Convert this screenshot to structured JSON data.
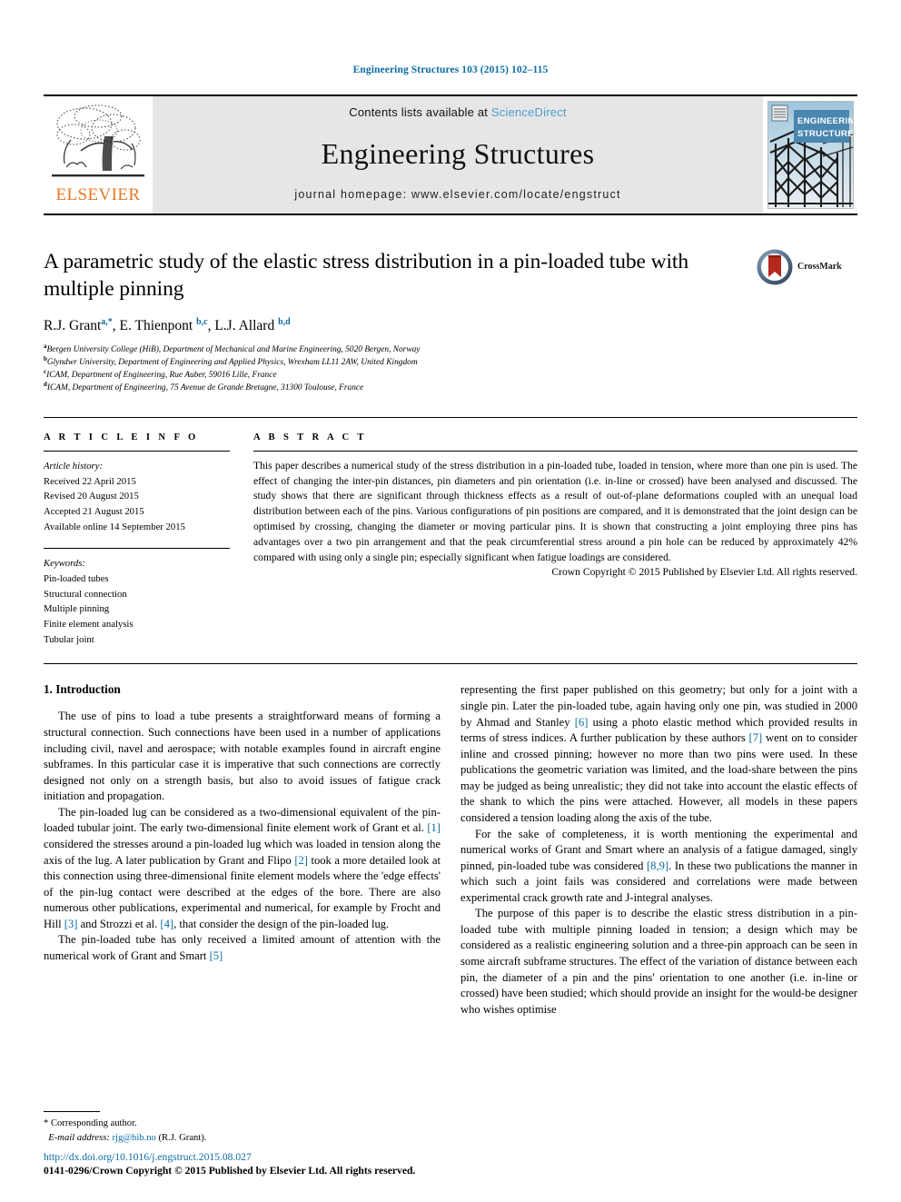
{
  "running_head": "Engineering Structures 103 (2015) 102–115",
  "banner": {
    "publisher_name": "ELSEVIER",
    "contents_prefix": "Contents lists available at ",
    "contents_link": "ScienceDirect",
    "journal_title": "Engineering Structures",
    "homepage": "journal homepage: www.elsevier.com/locate/engstruct",
    "cover_title_line1": "ENGINEERING",
    "cover_title_line2": "STRUCTURES"
  },
  "article": {
    "title": "A parametric study of the elastic stress distribution in a pin-loaded tube with multiple pinning",
    "crossmark_label": "CrossMark",
    "authors_html": "R.J. Grant<sup>a,*</sup>, E. Thienpont <sup>b,c</sup>, L.J. Allard <sup>b,d</sup>",
    "affiliations": [
      {
        "marker": "a",
        "text": "Bergen University College (HiB), Department of Mechanical and Marine Engineering, 5020 Bergen, Norway"
      },
      {
        "marker": "b",
        "text": "Glyndwr University, Department of Engineering and Applied Physics, Wrexham LL11 2AW, United Kingdom"
      },
      {
        "marker": "c",
        "text": "ICAM, Department of Engineering, Rue Auber, 59016 Lille, France"
      },
      {
        "marker": "d",
        "text": "ICAM, Department of Engineering, 75 Avenue de Grande Bretagne, 31300 Toulouse, France"
      }
    ]
  },
  "article_info": {
    "heading": "A R T I C L E   I N F O",
    "history_label": "Article history:",
    "history": [
      "Received 22 April 2015",
      "Revised 20 August 2015",
      "Accepted 21 August 2015",
      "Available online 14 September 2015"
    ],
    "keywords_label": "Keywords:",
    "keywords": [
      "Pin-loaded tubes",
      "Structural connection",
      "Multiple pinning",
      "Finite element analysis",
      "Tubular joint"
    ]
  },
  "abstract": {
    "heading": "A B S T R A C T",
    "text": "This paper describes a numerical study of the stress distribution in a pin-loaded tube, loaded in tension, where more than one pin is used. The effect of changing the inter-pin distances, pin diameters and pin orientation (i.e. in-line or crossed) have been analysed and discussed. The study shows that there are significant through thickness effects as a result of out-of-plane deformations coupled with an unequal load distribution between each of the pins. Various configurations of pin positions are compared, and it is demonstrated that the joint design can be optimised by crossing, changing the diameter or moving particular pins. It is shown that constructing a joint employing three pins has advantages over a two pin arrangement and that the peak circumferential stress around a pin hole can be reduced by approximately 42% compared with using only a single pin; especially significant when fatigue loadings are considered.",
    "copyright": "Crown Copyright © 2015 Published by Elsevier Ltd. All rights reserved."
  },
  "body": {
    "section_title": "1. Introduction",
    "left_paragraphs": [
      {
        "parts": [
          {
            "t": "The use of pins to load a tube presents a straightforward means of forming a structural connection. Such connections have been used in a number of applications including civil, navel and aerospace; with notable examples found in aircraft engine subframes. In this particular case it is imperative that such connections are correctly designed not only on a strength basis, but also to avoid issues of fatigue crack initiation and propagation."
          }
        ]
      },
      {
        "parts": [
          {
            "t": "The pin-loaded lug can be considered as a two-dimensional equivalent of the pin-loaded tubular joint. The early two-dimensional finite element work of Grant et al. "
          },
          {
            "t": "[1]",
            "ref": true
          },
          {
            "t": " considered the stresses around a pin-loaded lug which was loaded in tension along the axis of the lug. A later publication by Grant and Flipo "
          },
          {
            "t": "[2]",
            "ref": true
          },
          {
            "t": " took a more detailed look at this connection using three-dimensional finite element models where the 'edge effects' of the pin-lug contact were described at the edges of the bore. There are also numerous other publications, experimental and numerical, for example by Frocht and Hill "
          },
          {
            "t": "[3]",
            "ref": true
          },
          {
            "t": " and Strozzi et al. "
          },
          {
            "t": "[4]",
            "ref": true
          },
          {
            "t": ", that consider the design of the pin-loaded lug."
          }
        ]
      },
      {
        "parts": [
          {
            "t": "The pin-loaded tube has only received a limited amount of attention with the numerical work of Grant and Smart "
          },
          {
            "t": "[5]",
            "ref": true
          }
        ]
      }
    ],
    "right_paragraphs": [
      {
        "no_indent": true,
        "parts": [
          {
            "t": "representing the first paper published on this geometry; but only for a joint with a single pin. Later the pin-loaded tube, again having only one pin, was studied in 2000 by Ahmad and Stanley "
          },
          {
            "t": "[6]",
            "ref": true
          },
          {
            "t": " using a photo elastic method which provided results in terms of stress indices. A further publication by these authors "
          },
          {
            "t": "[7]",
            "ref": true
          },
          {
            "t": " went on to consider inline and crossed pinning; however no more than two pins were used. In these publications the geometric variation was limited, and the load-share between the pins may be judged as being unrealistic; they did not take into account the elastic effects of the shank to which the pins were attached. However, all models in these papers considered a tension loading along the axis of the tube."
          }
        ]
      },
      {
        "parts": [
          {
            "t": "For the sake of completeness, it is worth mentioning the experimental and numerical works of Grant and Smart where an analysis of a fatigue damaged, singly pinned, pin-loaded tube was considered "
          },
          {
            "t": "[8,9]",
            "ref": true
          },
          {
            "t": ". In these two publications the manner in which such a joint fails was considered and correlations were made between experimental crack growth rate and J-integral analyses."
          }
        ]
      },
      {
        "parts": [
          {
            "t": "The purpose of this paper is to describe the elastic stress distribution in a pin-loaded tube with multiple pinning loaded in tension; a design which may be considered as a realistic engineering solution and a three-pin approach can be seen in some aircraft subframe structures. The effect of the variation of distance between each pin, the diameter of a pin and the pins' orientation to one another (i.e. in-line or crossed) have been studied; which should provide an insight for the would-be designer who wishes optimise"
          }
        ]
      }
    ]
  },
  "footnote": {
    "corresponding": "* Corresponding author.",
    "email_label": "E-mail address:",
    "email": "rjg@hib.no",
    "email_suffix": "(R.J. Grant)."
  },
  "footer": {
    "doi": "http://dx.doi.org/10.1016/j.engstruct.2015.08.027",
    "issn_line": "0141-0296/Crown Copyright © 2015 Published by Elsevier Ltd. All rights reserved."
  },
  "colors": {
    "link_blue": "#0b6ca5",
    "sciencedirect_blue": "#4d9fd0",
    "elsevier_orange": "#e87722",
    "banner_gray": "#e6e6e6",
    "cover_blue": "#4a86b0"
  }
}
